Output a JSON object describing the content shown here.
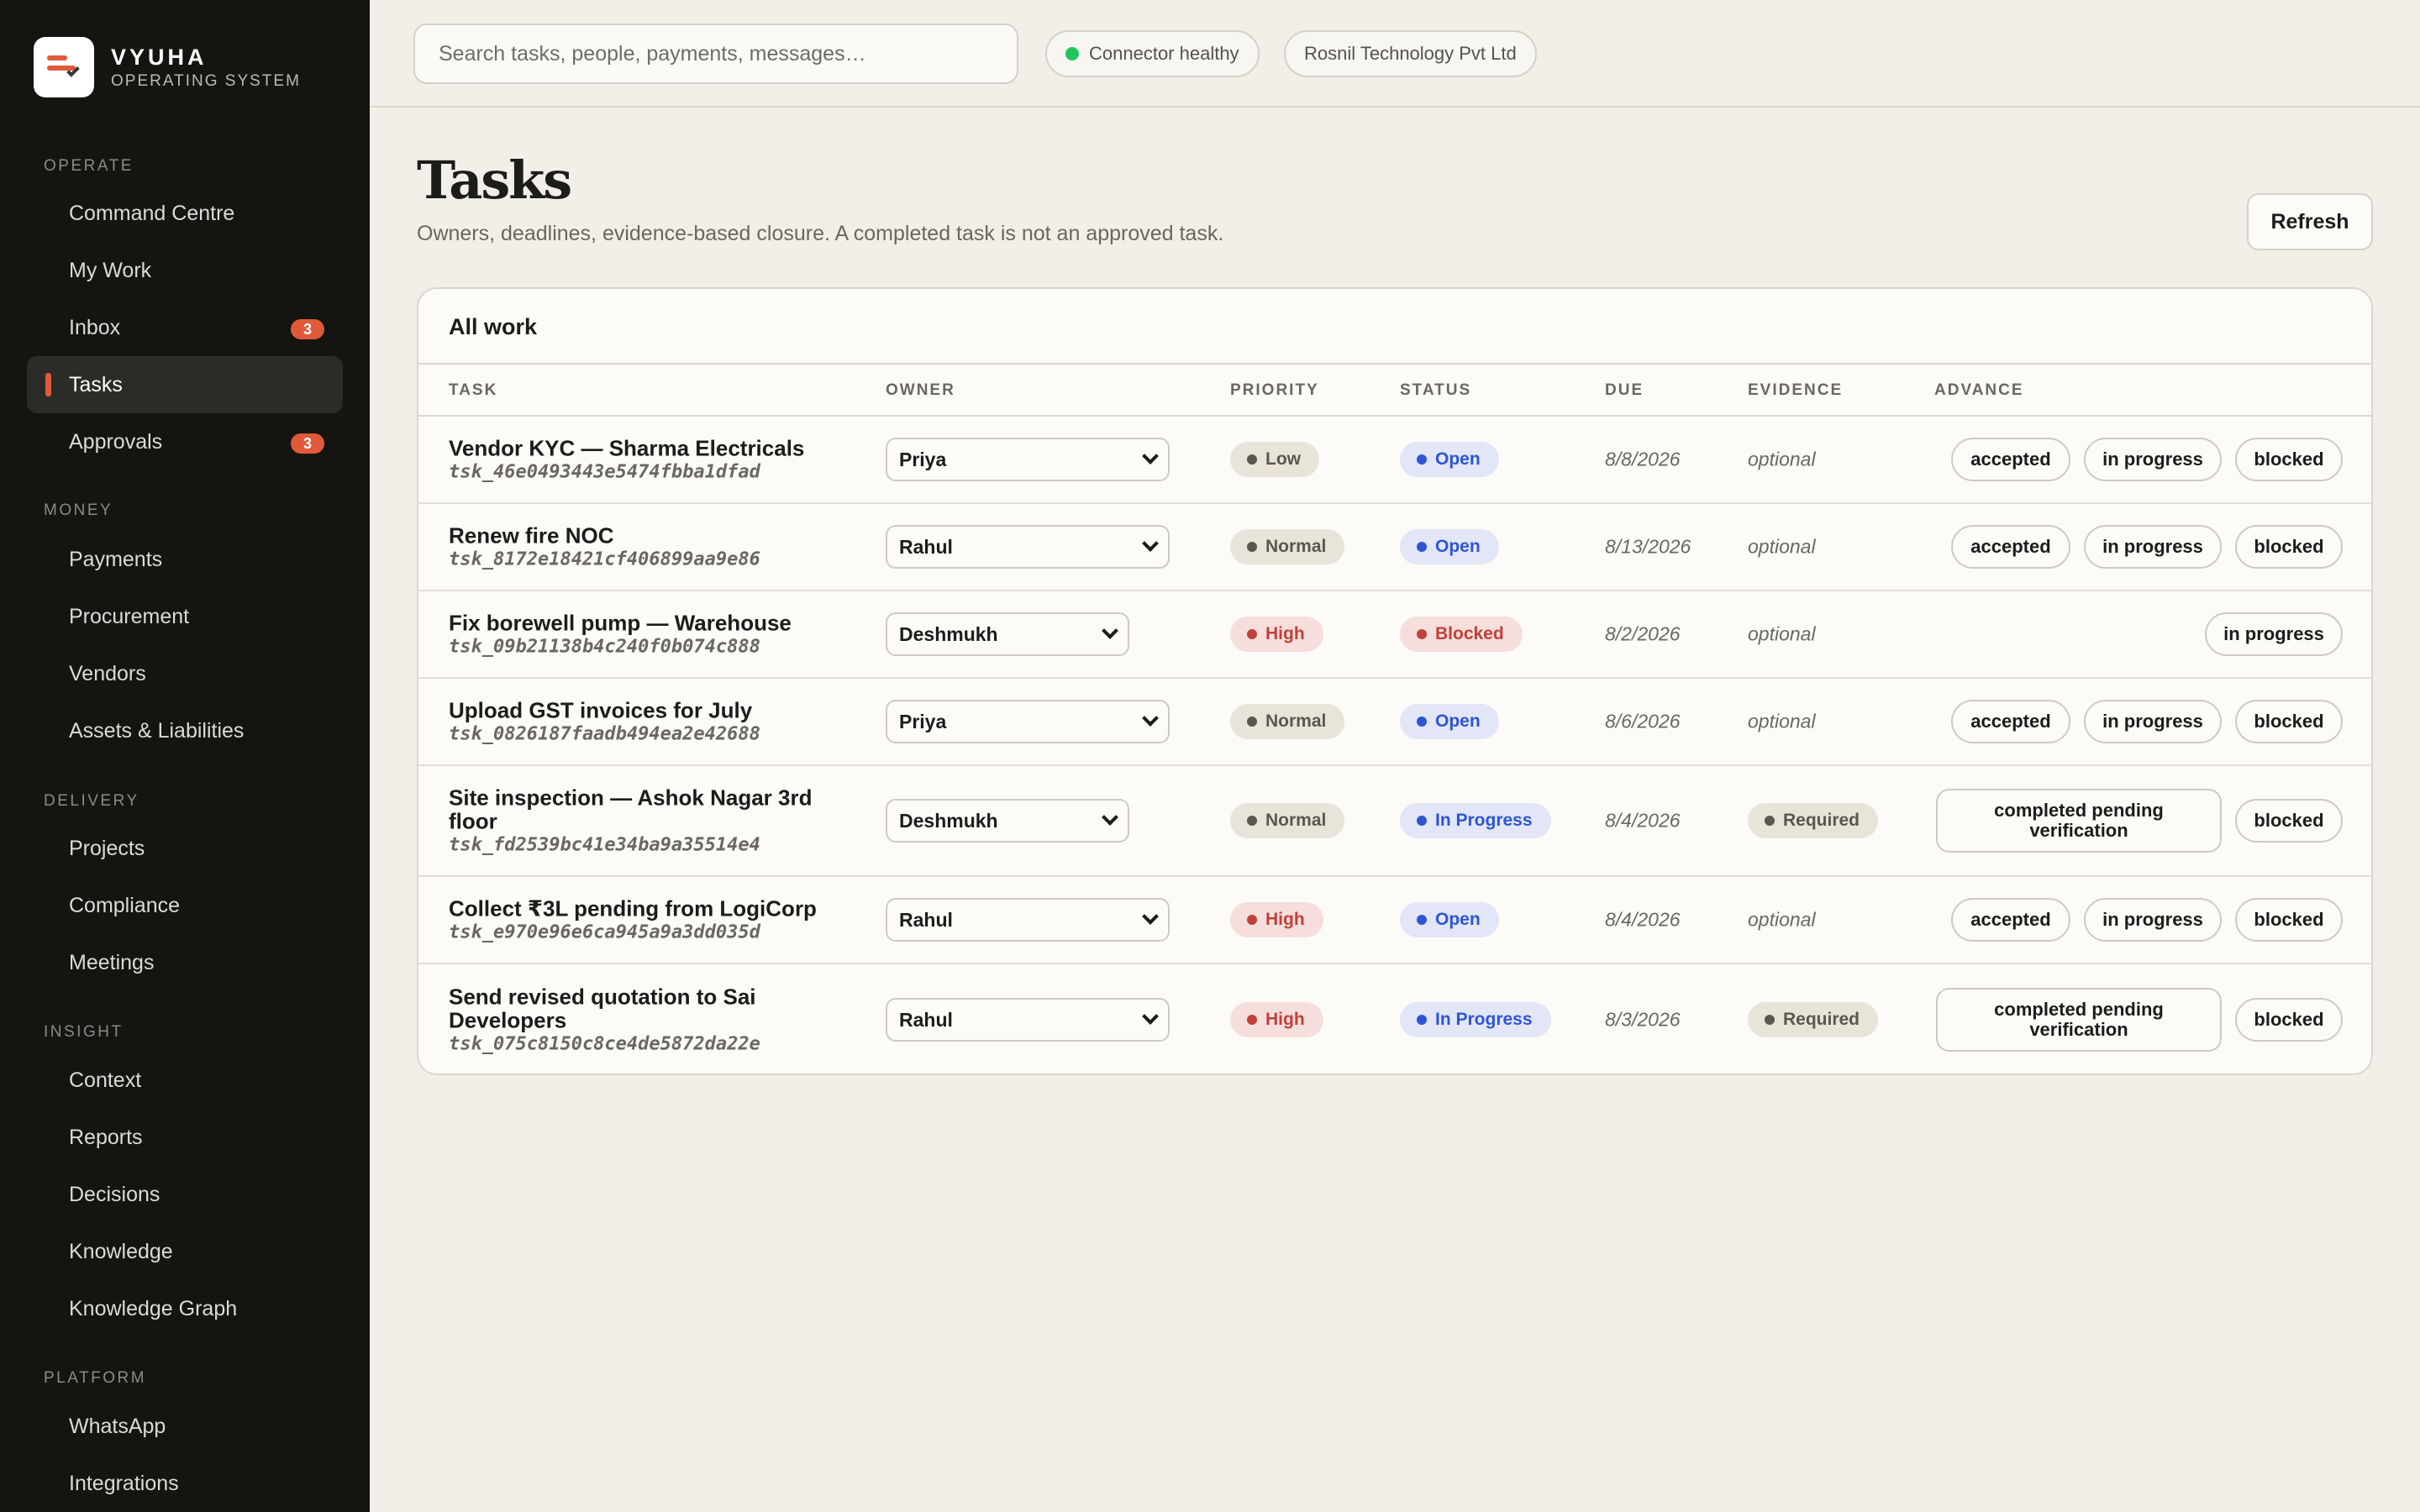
{
  "brand": {
    "name": "VYUHA",
    "subtitle": "OPERATING SYSTEM"
  },
  "sidebar": {
    "sections": [
      {
        "label": "OPERATE",
        "items": [
          {
            "label": "Command Centre"
          },
          {
            "label": "My Work"
          },
          {
            "label": "Inbox",
            "badge": "3"
          },
          {
            "label": "Tasks",
            "active": true
          },
          {
            "label": "Approvals",
            "badge": "3"
          }
        ]
      },
      {
        "label": "MONEY",
        "items": [
          {
            "label": "Payments"
          },
          {
            "label": "Procurement"
          },
          {
            "label": "Vendors"
          },
          {
            "label": "Assets & Liabilities"
          }
        ]
      },
      {
        "label": "DELIVERY",
        "items": [
          {
            "label": "Projects"
          },
          {
            "label": "Compliance"
          },
          {
            "label": "Meetings"
          }
        ]
      },
      {
        "label": "INSIGHT",
        "items": [
          {
            "label": "Context"
          },
          {
            "label": "Reports"
          },
          {
            "label": "Decisions"
          },
          {
            "label": "Knowledge"
          },
          {
            "label": "Knowledge Graph"
          }
        ]
      },
      {
        "label": "PLATFORM",
        "items": [
          {
            "label": "WhatsApp"
          },
          {
            "label": "Integrations"
          }
        ]
      }
    ]
  },
  "topbar": {
    "search_placeholder": "Search tasks, people, payments, messages…",
    "connector_status": "Connector healthy",
    "company": "Rosnil Technology Pvt Ltd"
  },
  "page": {
    "title": "Tasks",
    "subtitle": "Owners, deadlines, evidence-based closure. A completed task is not an approved task.",
    "refresh_label": "Refresh"
  },
  "table": {
    "card_title": "All work",
    "headers": {
      "task": "TASK",
      "owner": "OWNER",
      "priority": "PRIORITY",
      "status": "STATUS",
      "due": "DUE",
      "evidence": "EVIDENCE",
      "advance": "ADVANCE"
    },
    "rows": [
      {
        "title": "Vendor KYC — Sharma Electricals",
        "id": "tsk_46e0493443e5474fbba1dfad",
        "owner": "Priya",
        "priority": "Low",
        "status": "Open",
        "due": "8/8/2026",
        "evidence": "optional",
        "actions": [
          "accepted",
          "in progress",
          "blocked"
        ]
      },
      {
        "title": "Renew fire NOC",
        "id": "tsk_8172e18421cf406899aa9e86",
        "owner": "Rahul",
        "priority": "Normal",
        "status": "Open",
        "due": "8/13/2026",
        "evidence": "optional",
        "actions": [
          "accepted",
          "in progress",
          "blocked"
        ]
      },
      {
        "title": "Fix borewell pump — Warehouse",
        "id": "tsk_09b21138b4c240f0b074c888",
        "owner": "Deshmukh",
        "priority": "High",
        "status": "Blocked",
        "due": "8/2/2026",
        "evidence": "optional",
        "actions": [
          "in progress"
        ]
      },
      {
        "title": "Upload GST invoices for July",
        "id": "tsk_0826187faadb494ea2e42688",
        "owner": "Priya",
        "priority": "Normal",
        "status": "Open",
        "due": "8/6/2026",
        "evidence": "optional",
        "actions": [
          "accepted",
          "in progress",
          "blocked"
        ]
      },
      {
        "title": "Site inspection — Ashok Nagar 3rd floor",
        "id": "tsk_fd2539bc41e34ba9a35514e4",
        "owner": "Deshmukh",
        "priority": "Normal",
        "status": "In Progress",
        "due": "8/4/2026",
        "evidence": "Required",
        "actions": [
          "completed pending verification",
          "blocked"
        ]
      },
      {
        "title": "Collect ₹3L pending from LogiCorp",
        "id": "tsk_e970e96e6ca945a9a3dd035d",
        "owner": "Rahul",
        "priority": "High",
        "status": "Open",
        "due": "8/4/2026",
        "evidence": "optional",
        "actions": [
          "accepted",
          "in progress",
          "blocked"
        ]
      },
      {
        "title": "Send revised quotation to Sai Developers",
        "id": "tsk_075c8150c8ce4de5872da22e",
        "owner": "Rahul",
        "priority": "High",
        "status": "In Progress",
        "due": "8/3/2026",
        "evidence": "Required",
        "actions": [
          "completed pending verification",
          "blocked"
        ]
      }
    ]
  }
}
